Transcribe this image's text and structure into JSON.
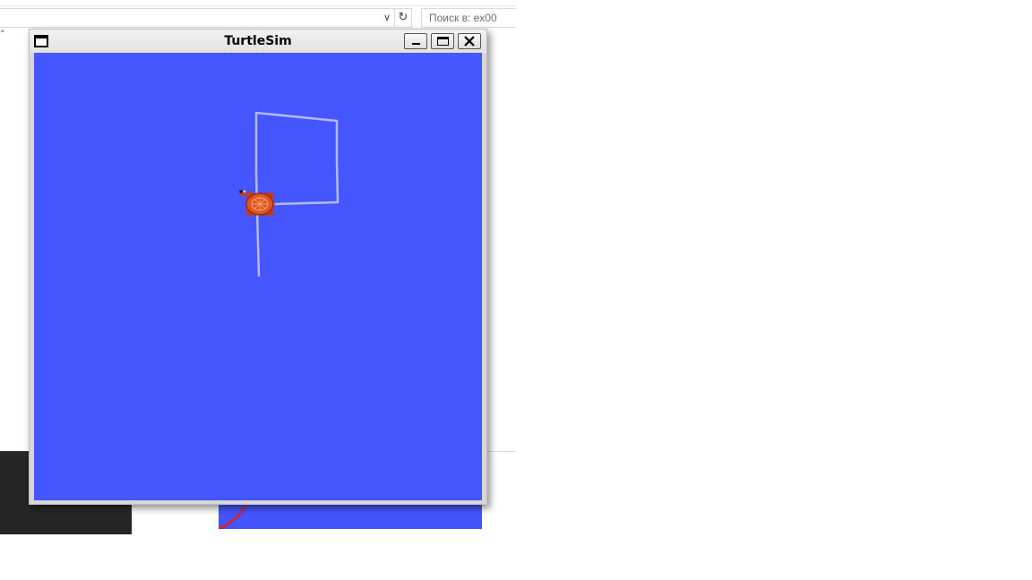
{
  "explorer": {
    "search_placeholder": "Поиск в: ex00"
  },
  "window": {
    "title": "TurtleSim"
  },
  "icons": {
    "app": "window-icon",
    "minimize": "minimize-icon",
    "maximize": "maximize-icon",
    "close": "close-icon",
    "refresh": "refresh-icon",
    "dropdown": "chevron-down-icon",
    "turtle": "turtle-icon"
  },
  "colors": {
    "canvas_background": "#4556ff",
    "trail": "#b3b8ff",
    "turtle_shell": "#e2541e",
    "dark_panel": "#262626"
  }
}
